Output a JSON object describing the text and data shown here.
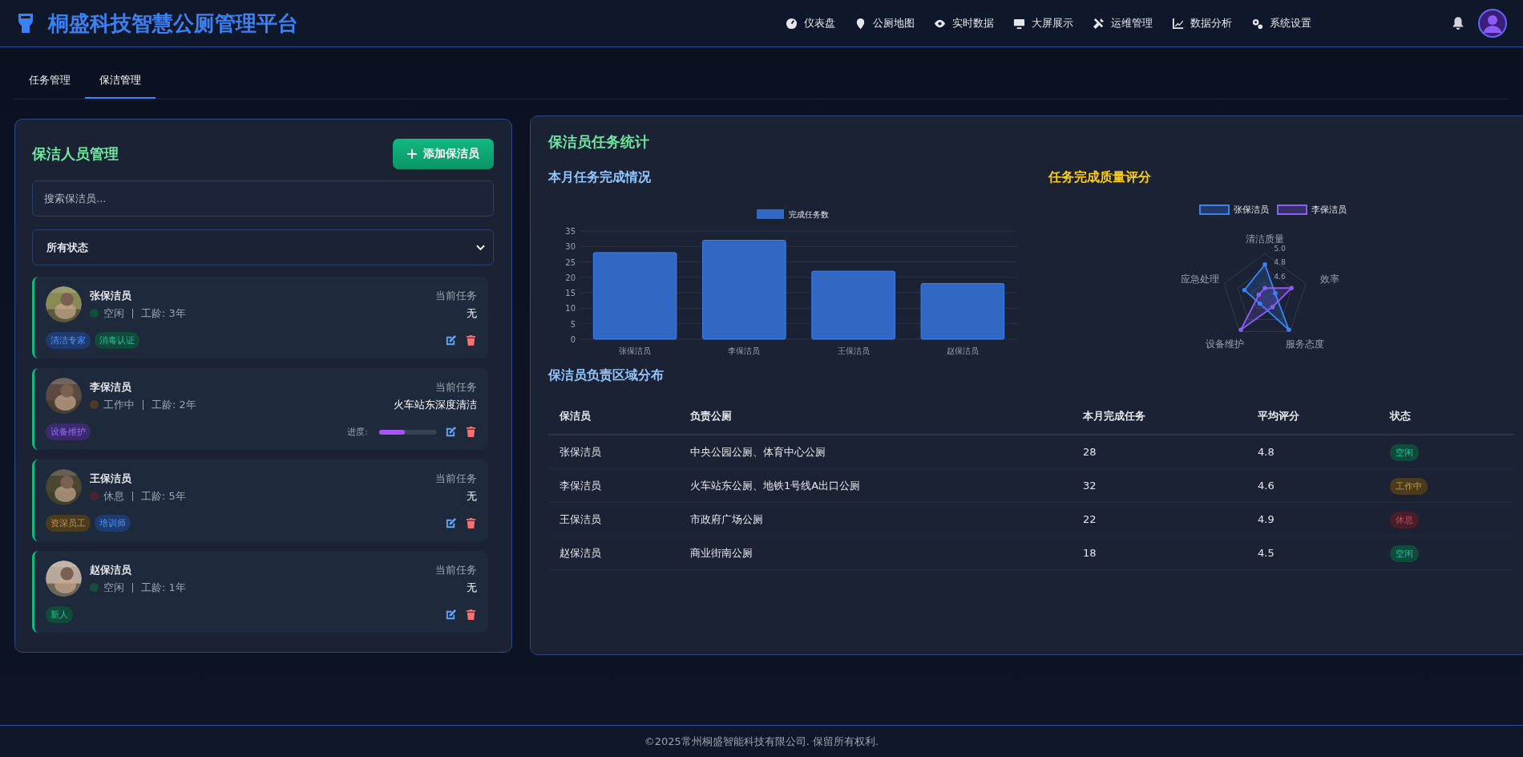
{
  "header": {
    "title": "桐盛科技智慧公厕管理平台",
    "nav": [
      {
        "kind": "gauge",
        "label": "仪表盘"
      },
      {
        "kind": "pin",
        "label": "公厕地图"
      },
      {
        "kind": "eye",
        "label": "实时数据"
      },
      {
        "kind": "monitor",
        "label": "大屏展示"
      },
      {
        "kind": "tools",
        "label": "运维管理"
      },
      {
        "kind": "chart",
        "label": "数据分析"
      },
      {
        "kind": "gears",
        "label": "系统设置"
      }
    ]
  },
  "tabs": [
    {
      "label": "任务管理",
      "selected": false
    },
    {
      "label": "保洁管理",
      "selected": true
    }
  ],
  "staff_panel": {
    "title": "保洁人员管理",
    "add_button": "添加保洁员",
    "search": {
      "placeholder": "搜索保洁员..."
    },
    "filter": {
      "value": "所有状态"
    },
    "cards": [
      {
        "name": "张保洁员",
        "status": {
          "label": "空闲",
          "color": "#134e3a"
        },
        "seniority": "工龄: 3年",
        "task_label": "当前任务",
        "task": "无",
        "tags": [
          {
            "label": "清洁专家",
            "color": "#1e3a6e"
          },
          {
            "label": "消毒认证",
            "color": "#0f4a3a"
          }
        ]
      },
      {
        "name": "李保洁员",
        "status": {
          "label": "工作中",
          "color": "#4a3b24"
        },
        "seniority": "工龄: 2年",
        "task_label": "当前任务",
        "task": "火车站东深度清洁",
        "tags": [
          {
            "label": "设备维护",
            "color": "#3b2a6e"
          }
        ],
        "progress": {
          "label": "进度:",
          "level": 0.45
        }
      },
      {
        "name": "王保洁员",
        "status": {
          "label": "休息",
          "color": "#4a2230"
        },
        "seniority": "工龄: 5年",
        "task_label": "当前任务",
        "task": "无",
        "tags": [
          {
            "label": "资深员工",
            "color": "#4a3a1e"
          },
          {
            "label": "培训师",
            "color": "#1e3a6e"
          }
        ]
      },
      {
        "name": "赵保洁员",
        "status": {
          "label": "空闲",
          "color": "#134e3a"
        },
        "seniority": "工龄: 1年",
        "task_label": "当前任务",
        "task": "无",
        "tags": [
          {
            "label": "新人",
            "color": "#0f4a3a"
          }
        ]
      }
    ]
  },
  "stats_panel": {
    "title": "保洁员任务统计",
    "bar_section": {
      "title": "本月任务完成情况",
      "chart_data": {
        "type": "bar",
        "categories": [
          "张保洁员",
          "李保洁员",
          "王保洁员",
          "赵保洁员"
        ],
        "series": [
          {
            "name": "完成任务数",
            "color": "#3068c4",
            "values": [
              28,
              32,
              22,
              18
            ]
          }
        ],
        "ylim": [
          0,
          35
        ],
        "grid": true,
        "yticks": [
          0,
          5,
          10,
          15,
          20,
          25,
          30,
          35
        ]
      }
    },
    "radar_section": {
      "title": "任务完成质量评分",
      "legend": [
        {
          "label": "张保洁员",
          "color": "#3b82f6"
        },
        {
          "label": "李保洁员",
          "color": "#8b5cf6"
        }
      ],
      "axes": [
        "清洁质量",
        "效率",
        "服务态度",
        "设备维护",
        "应急处理"
      ],
      "ticks": [
        "5.0",
        "4.8",
        "4.6"
      ]
    },
    "table_section": {
      "title": "保洁员负责区域分布",
      "columns": [
        "保洁员",
        "负责公厕",
        "本月完成任务",
        "平均评分",
        "状态"
      ],
      "rows": [
        {
          "cells": [
            "张保洁员",
            "中央公园公厕、体育中心公厕",
            "28",
            "4.8"
          ],
          "status": "空闲",
          "color": "#0f4a3a"
        },
        {
          "cells": [
            "李保洁员",
            "火车站东公厕、地铁1号线A出口公厕",
            "32",
            "4.6"
          ],
          "status": "工作中",
          "color": "#4a3a1e"
        },
        {
          "cells": [
            "王保洁员",
            "市政府广场公厕",
            "22",
            "4.9"
          ],
          "status": "休息",
          "color": "#4a1e28"
        },
        {
          "cells": [
            "赵保洁员",
            "商业街南公厕",
            "18",
            "4.5"
          ],
          "status": "空闲",
          "color": "#0f4a3a"
        }
      ]
    }
  },
  "footer": "©2025常州桐盛智能科技有限公司. 保留所有权利."
}
